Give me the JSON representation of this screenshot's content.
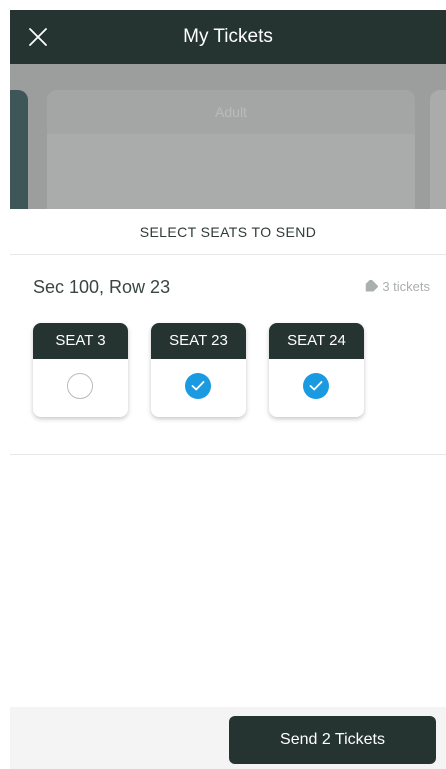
{
  "nav": {
    "title": "My Tickets",
    "close_icon": "close-icon"
  },
  "background": {
    "card_label": "Adult"
  },
  "sheet": {
    "title": "SELECT SEATS TO SEND",
    "section": "Sec 100, Row 23",
    "ticket_count": "3 tickets",
    "ticket_icon": "tag-icon",
    "seats": [
      {
        "label": "SEAT 3",
        "selected": false
      },
      {
        "label": "SEAT 23",
        "selected": true
      },
      {
        "label": "SEAT 24",
        "selected": true
      }
    ]
  },
  "footer": {
    "send_label": "Send 2 Tickets"
  },
  "colors": {
    "header": "#253430",
    "accent": "#1a9ae0",
    "muted": "#aab0ae"
  }
}
